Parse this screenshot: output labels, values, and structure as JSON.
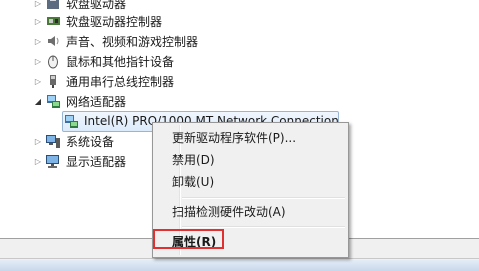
{
  "tree": {
    "items": [
      {
        "label": "软盘驱动器",
        "icon": "floppy-drive-icon",
        "expander": "▷"
      },
      {
        "label": "软盘驱动器控制器",
        "icon": "controller-icon",
        "expander": "▷"
      },
      {
        "label": "声音、视频和游戏控制器",
        "icon": "speaker-icon",
        "expander": "▷"
      },
      {
        "label": "鼠标和其他指针设备",
        "icon": "mouse-icon",
        "expander": "▷"
      },
      {
        "label": "通用串行总线控制器",
        "icon": "usb-icon",
        "expander": "▷"
      },
      {
        "label": "网络适配器",
        "icon": "network-adapter-icon",
        "expander": "◢"
      },
      {
        "label": "Intel(R) PRO/1000 MT Network Connection",
        "icon": "network-card-icon"
      },
      {
        "label": "系统设备",
        "icon": "computer-icon",
        "expander": "▷"
      },
      {
        "label": "显示适配器",
        "icon": "monitor-icon",
        "expander": "▷"
      }
    ]
  },
  "context_menu": {
    "items": [
      {
        "label": "更新驱动程序软件(P)..."
      },
      {
        "label": "禁用(D)"
      },
      {
        "label": "卸载(U)"
      },
      {
        "label": "扫描检测硬件改动(A)"
      },
      {
        "label": "属性(R)"
      }
    ]
  },
  "colors": {
    "highlight_border": "#e03030",
    "selection_border": "#9ab5d4"
  }
}
